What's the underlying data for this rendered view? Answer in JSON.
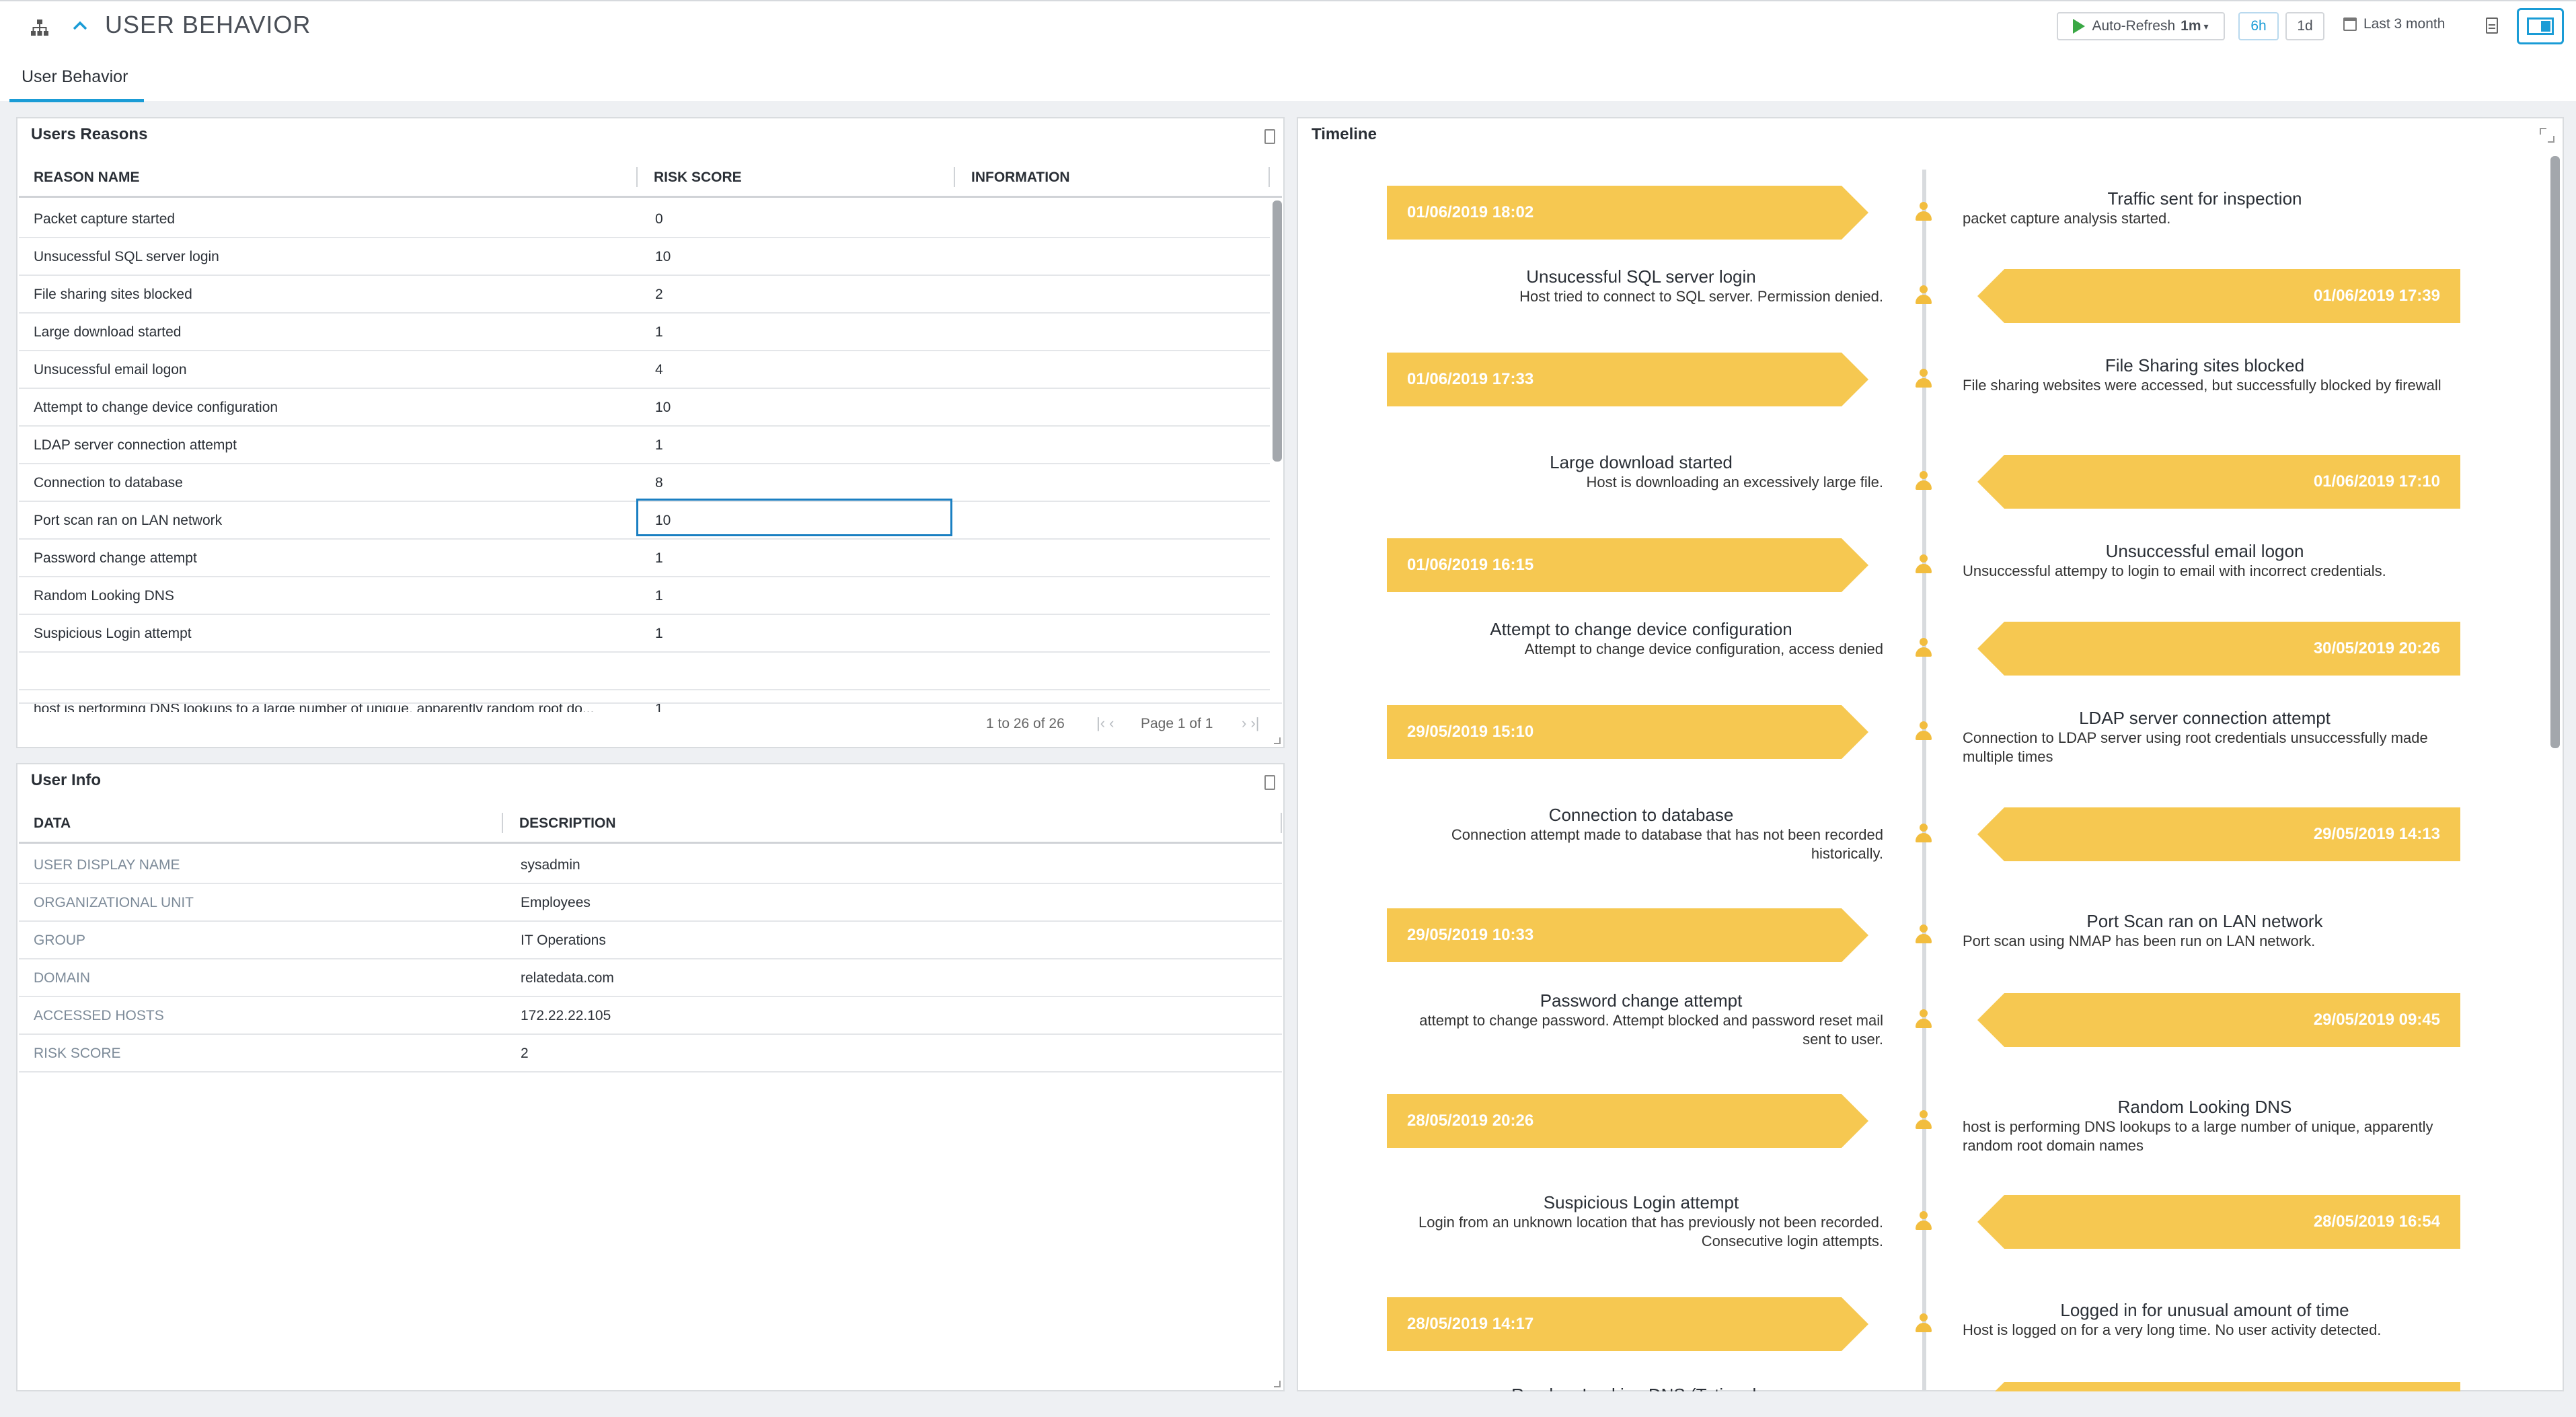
{
  "header": {
    "title": "USER BEHAVIOR",
    "tab": "User Behavior",
    "auto_refresh_label": "Auto-Refresh",
    "auto_refresh_interval": "1m",
    "range_6h": "6h",
    "range_1d": "1d",
    "time_range": "Last 3 month"
  },
  "users_reasons": {
    "title": "Users Reasons",
    "columns": [
      "REASON NAME",
      "RISK SCORE",
      "INFORMATION"
    ],
    "rows": [
      [
        "Packet capture started",
        "0"
      ],
      [
        "Unsucessful SQL server login",
        "10"
      ],
      [
        "File sharing sites blocked",
        "2"
      ],
      [
        "Large download started",
        "1"
      ],
      [
        "Unsucessful email logon",
        "4"
      ],
      [
        "Attempt to change device configuration",
        "10"
      ],
      [
        "LDAP server connection attempt",
        "1"
      ],
      [
        "Connection to database",
        "8"
      ],
      [
        "Port scan ran on LAN network",
        "10"
      ],
      [
        "Password change attempt",
        "1"
      ],
      [
        "Random Looking DNS",
        "1"
      ],
      [
        "Suspicious Login attempt",
        "1"
      ],
      [
        "",
        ""
      ],
      [
        "host is performing DNS lookups to a large number of unique, apparently random root do...",
        "1"
      ]
    ],
    "pager_count": "1 to 26 of 26",
    "pager_page": "Page 1 of 1"
  },
  "user_info": {
    "title": "User Info",
    "columns": [
      "DATA",
      "DESCRIPTION"
    ],
    "rows": [
      [
        "USER DISPLAY NAME",
        "sysadmin"
      ],
      [
        "ORGANIZATIONAL UNIT",
        "Employees"
      ],
      [
        "GROUP",
        "IT Operations"
      ],
      [
        "DOMAIN",
        "relatedata.com"
      ],
      [
        "ACCESSED HOSTS",
        "172.22.22.105"
      ],
      [
        "RISK SCORE",
        "2"
      ]
    ]
  },
  "timeline": {
    "title": "Timeline",
    "events": [
      {
        "date": "01/06/2019 18:02",
        "title": "Traffic sent for inspection",
        "desc": "packet capture analysis started."
      },
      {
        "date": "01/06/2019 17:39",
        "title": "Unsucessful SQL server login",
        "desc": "Host tried to connect to SQL server. Permission denied."
      },
      {
        "date": "01/06/2019 17:33",
        "title": "File Sharing sites blocked",
        "desc": "File sharing websites were accessed, but successfully blocked by firewall"
      },
      {
        "date": "01/06/2019 17:10",
        "title": "Large download started",
        "desc": "Host is downloading an excessively large file."
      },
      {
        "date": "01/06/2019 16:15",
        "title": "Unsuccessful email logon",
        "desc": "Unsuccessful attempy to login to email with incorrect credentials."
      },
      {
        "date": "30/05/2019 20:26",
        "title": "Attempt to change device configuration",
        "desc": "Attempt to change device configuration, access denied"
      },
      {
        "date": "29/05/2019 15:10",
        "title": "LDAP server connection attempt",
        "desc": "Connection to LDAP server using root credentials unsuccessfully made multiple times"
      },
      {
        "date": "29/05/2019 14:13",
        "title": "Connection to database",
        "desc": "Connection attempt made to database that has not been recorded historically."
      },
      {
        "date": "29/05/2019 10:33",
        "title": "Port Scan ran on LAN network",
        "desc": "Port scan using NMAP has been run on LAN network."
      },
      {
        "date": "29/05/2019 09:45",
        "title": "Password change attempt",
        "desc": "attempt to change password. Attempt blocked and password reset mail sent to user."
      },
      {
        "date": "28/05/2019 20:26",
        "title": "Random Looking DNS",
        "desc": "host is performing DNS lookups to a large number of unique, apparently random root domain names"
      },
      {
        "date": "28/05/2019 16:54",
        "title": "Suspicious Login attempt",
        "desc": "Login from an unknown location that has previously not been recorded. Consecutive login attempts."
      },
      {
        "date": "28/05/2019 14:17",
        "title": "Logged in for unusual amount of time",
        "desc": "Host is logged on for a very long time. No user activity detected."
      }
    ],
    "clipped_title": "Random Looking DNS (Tatianal..."
  },
  "colors": {
    "accent": "#1a9cd6",
    "banner": "#f6c851",
    "person": "#f2bd3e"
  }
}
